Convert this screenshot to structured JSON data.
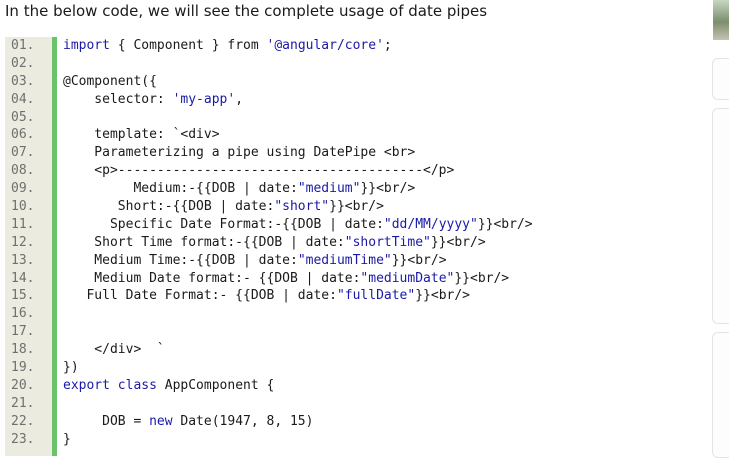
{
  "intro_text": "In the below code, we will see the complete usage of date pipes",
  "code_lines": [
    {
      "num": "01.",
      "parts": [
        [
          "kw",
          "import"
        ],
        [
          "t",
          " { Component } from "
        ],
        [
          "str",
          "'@angular/core'"
        ],
        [
          "t",
          ";"
        ]
      ]
    },
    {
      "num": "02.",
      "parts": []
    },
    {
      "num": "03.",
      "parts": [
        [
          "t",
          "@Component({"
        ]
      ]
    },
    {
      "num": "04.",
      "parts": [
        [
          "t",
          "    selector: "
        ],
        [
          "str",
          "'my-app'"
        ],
        [
          "t",
          ","
        ]
      ]
    },
    {
      "num": "05.",
      "parts": []
    },
    {
      "num": "06.",
      "parts": [
        [
          "t",
          "    template: `<div>"
        ]
      ]
    },
    {
      "num": "07.",
      "parts": [
        [
          "t",
          "    Parameterizing a pipe using DatePipe <br>"
        ]
      ]
    },
    {
      "num": "08.",
      "parts": [
        [
          "t",
          "    <p>---------------------------------------</p>"
        ]
      ]
    },
    {
      "num": "09.",
      "parts": [
        [
          "t",
          "         Medium:-{{DOB | date:"
        ],
        [
          "str",
          "\"medium\""
        ],
        [
          "t",
          "}}<br/>"
        ]
      ]
    },
    {
      "num": "10.",
      "parts": [
        [
          "t",
          "       Short:-{{DOB | date:"
        ],
        [
          "str",
          "\"short\""
        ],
        [
          "t",
          "}}<br/>"
        ]
      ]
    },
    {
      "num": "11.",
      "parts": [
        [
          "t",
          "      Specific Date Format:-{{DOB | date:"
        ],
        [
          "str",
          "\"dd/MM/yyyy\""
        ],
        [
          "t",
          "}}<br/>"
        ]
      ]
    },
    {
      "num": "12.",
      "parts": [
        [
          "t",
          "    Short Time format:-{{DOB | date:"
        ],
        [
          "str",
          "\"shortTime\""
        ],
        [
          "t",
          "}}<br/>"
        ]
      ]
    },
    {
      "num": "13.",
      "parts": [
        [
          "t",
          "    Medium Time:-{{DOB | date:"
        ],
        [
          "str",
          "\"mediumTime\""
        ],
        [
          "t",
          "}}<br/>"
        ]
      ]
    },
    {
      "num": "14.",
      "parts": [
        [
          "t",
          "    Medium Date format:- {{DOB | date:"
        ],
        [
          "str",
          "\"mediumDate\""
        ],
        [
          "t",
          "}}<br/>"
        ]
      ]
    },
    {
      "num": "15.",
      "parts": [
        [
          "t",
          "   Full Date Format:- {{DOB | date:"
        ],
        [
          "str",
          "\"fullDate\""
        ],
        [
          "t",
          "}}<br/>"
        ]
      ]
    },
    {
      "num": "16.",
      "parts": []
    },
    {
      "num": "17.",
      "parts": []
    },
    {
      "num": "18.",
      "parts": [
        [
          "t",
          "    </div>  `"
        ]
      ]
    },
    {
      "num": "19.",
      "parts": [
        [
          "t",
          "})"
        ]
      ]
    },
    {
      "num": "20.",
      "parts": [
        [
          "kw",
          "export class"
        ],
        [
          "t",
          " AppComponent {"
        ]
      ]
    },
    {
      "num": "21.",
      "parts": []
    },
    {
      "num": "22.",
      "parts": [
        [
          "t",
          "     DOB = "
        ],
        [
          "kw",
          "new"
        ],
        [
          "t",
          " Date(1947, 8, 15)"
        ]
      ]
    },
    {
      "num": "23.",
      "parts": [
        [
          "t",
          "}"
        ]
      ]
    }
  ],
  "colors": {
    "gutter": "#ebebe0",
    "gutter_bar": "#6ac36a",
    "keyword": "#1a1aa6",
    "string": "#1a1aa6"
  }
}
